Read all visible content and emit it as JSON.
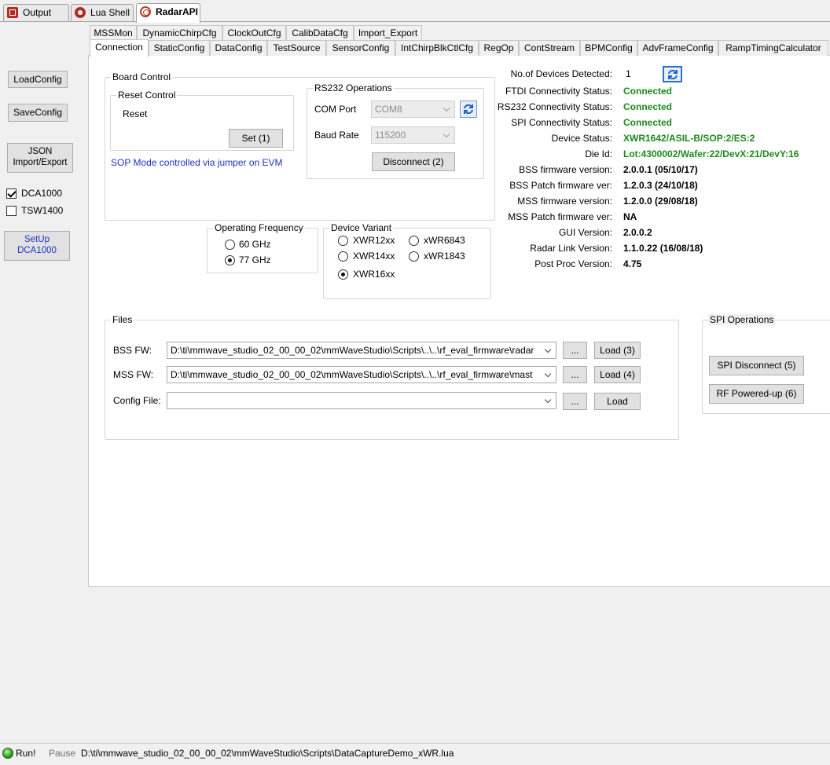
{
  "doc_tabs": [
    {
      "label": "Output",
      "icon": "output-icon"
    },
    {
      "label": "Lua Shell",
      "icon": "lua-shell-icon"
    },
    {
      "label": "RadarAPI",
      "icon": "radar-api-icon",
      "active": true
    }
  ],
  "left_panel": {
    "load_config": "LoadConfig",
    "save_config": "SaveConfig",
    "json_line1": "JSON",
    "json_line2": "Import/Export",
    "dca1000": {
      "label": "DCA1000",
      "checked": true
    },
    "tsw1400": {
      "label": "TSW1400",
      "checked": false
    },
    "setup_line1": "SetUp",
    "setup_line2": "DCA1000"
  },
  "tabs_row1": [
    "MSSMon",
    "DynamicChirpCfg",
    "ClockOutCfg",
    "CalibDataCfg",
    "Import_Export"
  ],
  "tabs_row2": [
    "Connection",
    "StaticConfig",
    "DataConfig",
    "TestSource",
    "SensorConfig",
    "IntChirpBlkCtlCfg",
    "RegOp",
    "ContStream",
    "BPMConfig",
    "AdvFrameConfig",
    "RampTimingCalculator"
  ],
  "active_tab": "Connection",
  "board_control": {
    "title": "Board Control",
    "reset_control_title": "Reset Control",
    "reset_label": "Reset",
    "set_button": "Set (1)",
    "sop_note": "SOP Mode controlled via jumper on EVM"
  },
  "rs232": {
    "title": "RS232 Operations",
    "com_port_label": "COM Port",
    "com_port_value": "COM8",
    "baud_label": "Baud Rate",
    "baud_value": "115200",
    "disconnect_button": "Disconnect (2)"
  },
  "operating_frequency": {
    "title": "Operating Frequency",
    "options": [
      {
        "label": "60 GHz",
        "selected": false
      },
      {
        "label": "77 GHz",
        "selected": true
      }
    ]
  },
  "device_variant": {
    "title": "Device Variant",
    "options": [
      {
        "label": "XWR12xx",
        "selected": false
      },
      {
        "label": "xWR6843",
        "selected": false
      },
      {
        "label": "XWR14xx",
        "selected": false
      },
      {
        "label": "xWR1843",
        "selected": false
      },
      {
        "label": "XWR16xx",
        "selected": true
      }
    ]
  },
  "device_info": [
    {
      "label": "No.of Devices Detected:",
      "value": "1",
      "color": "#000000"
    },
    {
      "label": "FTDI Connectivity Status:",
      "value": "Connected",
      "color": "#1c8a1c"
    },
    {
      "label": "RS232 Connectivity Status:",
      "value": "Connected",
      "color": "#1c8a1c"
    },
    {
      "label": "SPI Connectivity Status:",
      "value": "Connected",
      "color": "#1c8a1c"
    },
    {
      "label": "Device Status:",
      "value": "XWR1642/ASIL-B/SOP:2/ES:2",
      "color": "#1c8a1c"
    },
    {
      "label": "Die Id:",
      "value": "Lot:4300002/Wafer:22/DevX:21/DevY:16",
      "color": "#1c8a1c"
    },
    {
      "label": "BSS firmware version:",
      "value": "2.0.0.1 (05/10/17)",
      "color": "#000000"
    },
    {
      "label": "BSS Patch firmware ver:",
      "value": "1.2.0.3 (24/10/18)",
      "color": "#000000"
    },
    {
      "label": "MSS firmware version:",
      "value": "1.2.0.0 (29/08/18)",
      "color": "#000000"
    },
    {
      "label": "MSS Patch firmware ver:",
      "value": "NA",
      "color": "#000000"
    },
    {
      "label": "GUI Version:",
      "value": "2.0.0.2",
      "color": "#000000"
    },
    {
      "label": "Radar Link Version:",
      "value": "1.1.0.22 (16/08/18)",
      "color": "#000000"
    },
    {
      "label": "Post Proc Version:",
      "value": "4.75",
      "color": "#000000"
    }
  ],
  "files": {
    "title": "Files",
    "bss_label": "BSS FW:",
    "bss_value": "D:\\ti\\mmwave_studio_02_00_00_02\\mmWaveStudio\\Scripts\\..\\..\\rf_eval_firmware\\radar",
    "bss_load": "Load (3)",
    "mss_label": "MSS FW:",
    "mss_value": "D:\\ti\\mmwave_studio_02_00_00_02\\mmWaveStudio\\Scripts\\..\\..\\rf_eval_firmware\\mast",
    "mss_load": "Load (4)",
    "config_label": "Config File:",
    "config_value": "",
    "config_load": "Load",
    "browse": "..."
  },
  "spi": {
    "title": "SPI Operations",
    "disconnect": "SPI Disconnect (5)",
    "rf_powered": "RF Powered-up (6)"
  },
  "status_bar": {
    "run": "Run!",
    "pause": "Pause",
    "script_path": "D:\\ti\\mmwave_studio_02_00_00_02\\mmWaveStudio\\Scripts\\DataCaptureDemo_xWR.lua"
  }
}
